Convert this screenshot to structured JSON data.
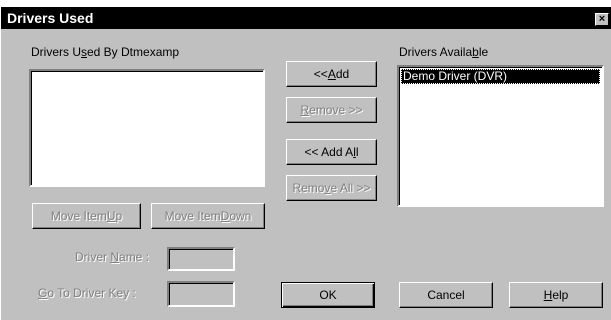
{
  "window": {
    "title": "Drivers Used",
    "close_glyph": "×"
  },
  "left_panel": {
    "label": {
      "pre": "Drivers U",
      "accel": "s",
      "post": "ed By Dtmexamp"
    },
    "items": []
  },
  "right_panel": {
    "label": {
      "pre": "Drivers Availa",
      "accel": "b",
      "post": "le"
    },
    "items": [
      {
        "label": "Demo Driver (DVR)",
        "selected": true
      }
    ]
  },
  "transfer_buttons": {
    "add": {
      "pre": "<< ",
      "accel": "A",
      "post": "dd",
      "enabled": true
    },
    "remove": {
      "pre": "",
      "accel": "R",
      "post": "emove >>",
      "enabled": false
    },
    "add_all": {
      "pre": "<< Add A",
      "accel": "l",
      "post": "l",
      "enabled": true
    },
    "remove_all": {
      "pre": "Remo",
      "accel": "v",
      "post": "e All >>",
      "enabled": false
    }
  },
  "move_buttons": {
    "up": {
      "pre": "Move Item ",
      "accel": "U",
      "post": "p",
      "enabled": false
    },
    "down": {
      "pre": "Move Item ",
      "accel": "D",
      "post": "own",
      "enabled": false
    }
  },
  "fields": {
    "driver_name": {
      "pre": "Driver ",
      "accel": "N",
      "post": "ame :",
      "value": ""
    },
    "go_to_driver_key": {
      "pre": "",
      "accel": "G",
      "post": "o To Driver Key :",
      "value": ""
    }
  },
  "bottom_buttons": {
    "ok": {
      "label": "OK"
    },
    "cancel": {
      "label": "Cancel"
    },
    "help": {
      "pre": "",
      "accel": "H",
      "post": "elp"
    }
  }
}
